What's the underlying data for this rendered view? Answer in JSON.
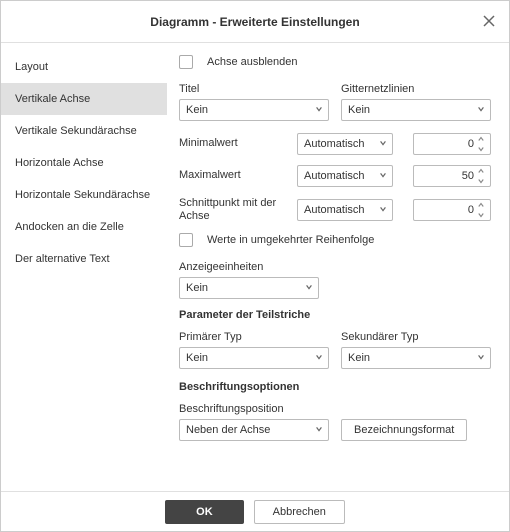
{
  "title": "Diagramm - Erweiterte Einstellungen",
  "sidebar": {
    "items": [
      {
        "label": "Layout"
      },
      {
        "label": "Vertikale Achse"
      },
      {
        "label": "Vertikale Sekundärachse"
      },
      {
        "label": "Horizontale Achse"
      },
      {
        "label": "Horizontale Sekundärachse"
      },
      {
        "label": "Andocken an die Zelle"
      },
      {
        "label": "Der alternative Text"
      }
    ],
    "active_index": 1
  },
  "content": {
    "hide_axis_label": "Achse ausblenden",
    "title_label": "Titel",
    "title_value": "Kein",
    "gridlines_label": "Gitternetzlinien",
    "gridlines_value": "Kein",
    "min_label": "Minimalwert",
    "min_mode": "Automatisch",
    "min_value": "0",
    "max_label": "Maximalwert",
    "max_mode": "Automatisch",
    "max_value": "50",
    "cross_label": "Schnittpunkt mit der Achse",
    "cross_mode": "Automatisch",
    "cross_value": "0",
    "reverse_label": "Werte in umgekehrter Reihenfolge",
    "display_units_label": "Anzeigeeinheiten",
    "display_units_value": "Kein",
    "tick_section": "Parameter der Teilstriche",
    "primary_type_label": "Primärer Typ",
    "primary_type_value": "Kein",
    "secondary_type_label": "Sekundärer Typ",
    "secondary_type_value": "Kein",
    "label_section": "Beschriftungsoptionen",
    "label_pos_label": "Beschriftungsposition",
    "label_pos_value": "Neben der Achse",
    "label_format_btn": "Bezeichnungsformat"
  },
  "footer": {
    "ok": "OK",
    "cancel": "Abbrechen"
  }
}
